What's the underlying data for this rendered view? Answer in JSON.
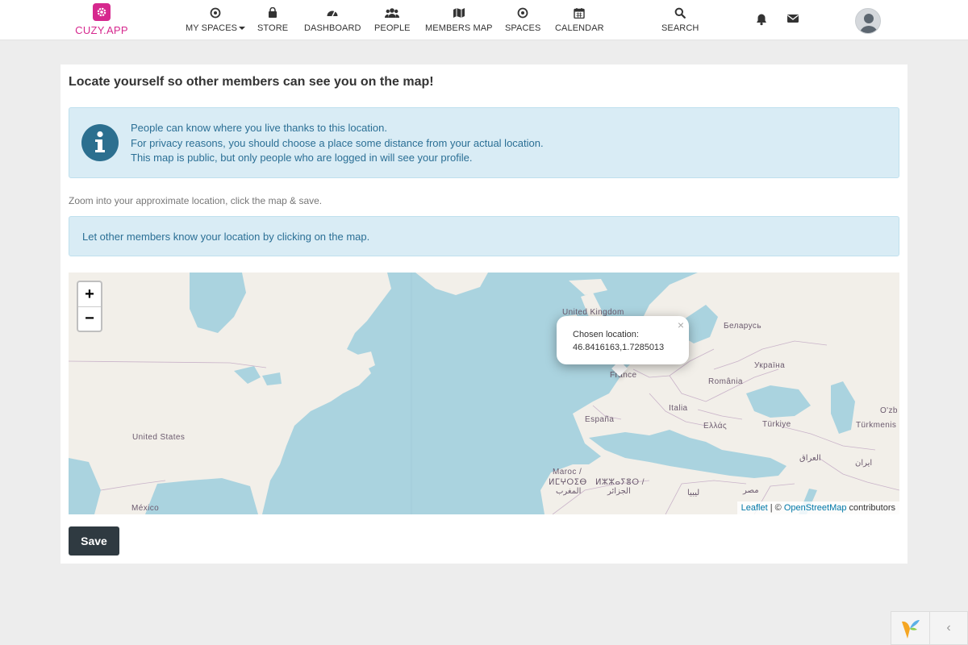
{
  "brand": {
    "name": "CUZY.APP",
    "color": "#d6288e"
  },
  "nav": [
    {
      "label": "MY SPACES",
      "icon": "target-icon"
    },
    {
      "label": "STORE",
      "icon": "shopping-bag-icon"
    },
    {
      "label": "DASHBOARD",
      "icon": "dashboard-icon"
    },
    {
      "label": "PEOPLE",
      "icon": "people-icon"
    },
    {
      "label": "MEMBERS MAP",
      "icon": "map-icon"
    },
    {
      "label": "SPACES",
      "icon": "target-icon"
    },
    {
      "label": "CALENDAR",
      "icon": "calendar-icon"
    },
    {
      "label": "SEARCH",
      "icon": "search-icon"
    }
  ],
  "page": {
    "title": "Locate yourself so other members can see you on the map!",
    "info_lines": [
      "People can know where you live thanks to this location.",
      "For privacy reasons, you should choose a place some distance from your actual location.",
      "This map is public, but only people who are logged in will see your profile."
    ],
    "hint": "Zoom into your approximate location, click the map & save.",
    "alert": "Let other members know your location by clicking on the map.",
    "save_label": "Save"
  },
  "map": {
    "zoom_in": "+",
    "zoom_out": "−",
    "popup_title": "Chosen location:",
    "popup_coords": "46.8416163,1.7285013",
    "popup_close": "×",
    "attribution_leaflet": "Leaflet",
    "attribution_sep": " | © ",
    "attribution_osm": "OpenStreetMap",
    "attribution_tail": " contributors",
    "labels": {
      "uk": "United Kingdom",
      "belarus": "Беларусь",
      "ukraine": "Україна",
      "france": "France",
      "romania": "România",
      "espana": "España",
      "italia": "Italia",
      "greece": "Ελλάς",
      "turkey": "Türkiye",
      "uzbek": "O'zb",
      "turkmen": "Türkmenis",
      "usa": "United States",
      "iraq": "العراق",
      "iran": "ایران",
      "maroc1": "Maroc /",
      "maroc2": "ⵍⵎⵖⵔⵉⴱ",
      "maroc3": "المغرب",
      "algeria1": "ⵍⵣⵣⴰⵢⴻⵔ /",
      "algeria2": "الجزائر",
      "libya": "ليبيا",
      "egypt": "مصر",
      "mexico": "México"
    }
  },
  "colors": {
    "info_text": "#2b6f95",
    "info_bg": "#d9ecf5",
    "save_bg": "#2f3a41",
    "water": "#aad3df",
    "land": "#f2efe9"
  }
}
